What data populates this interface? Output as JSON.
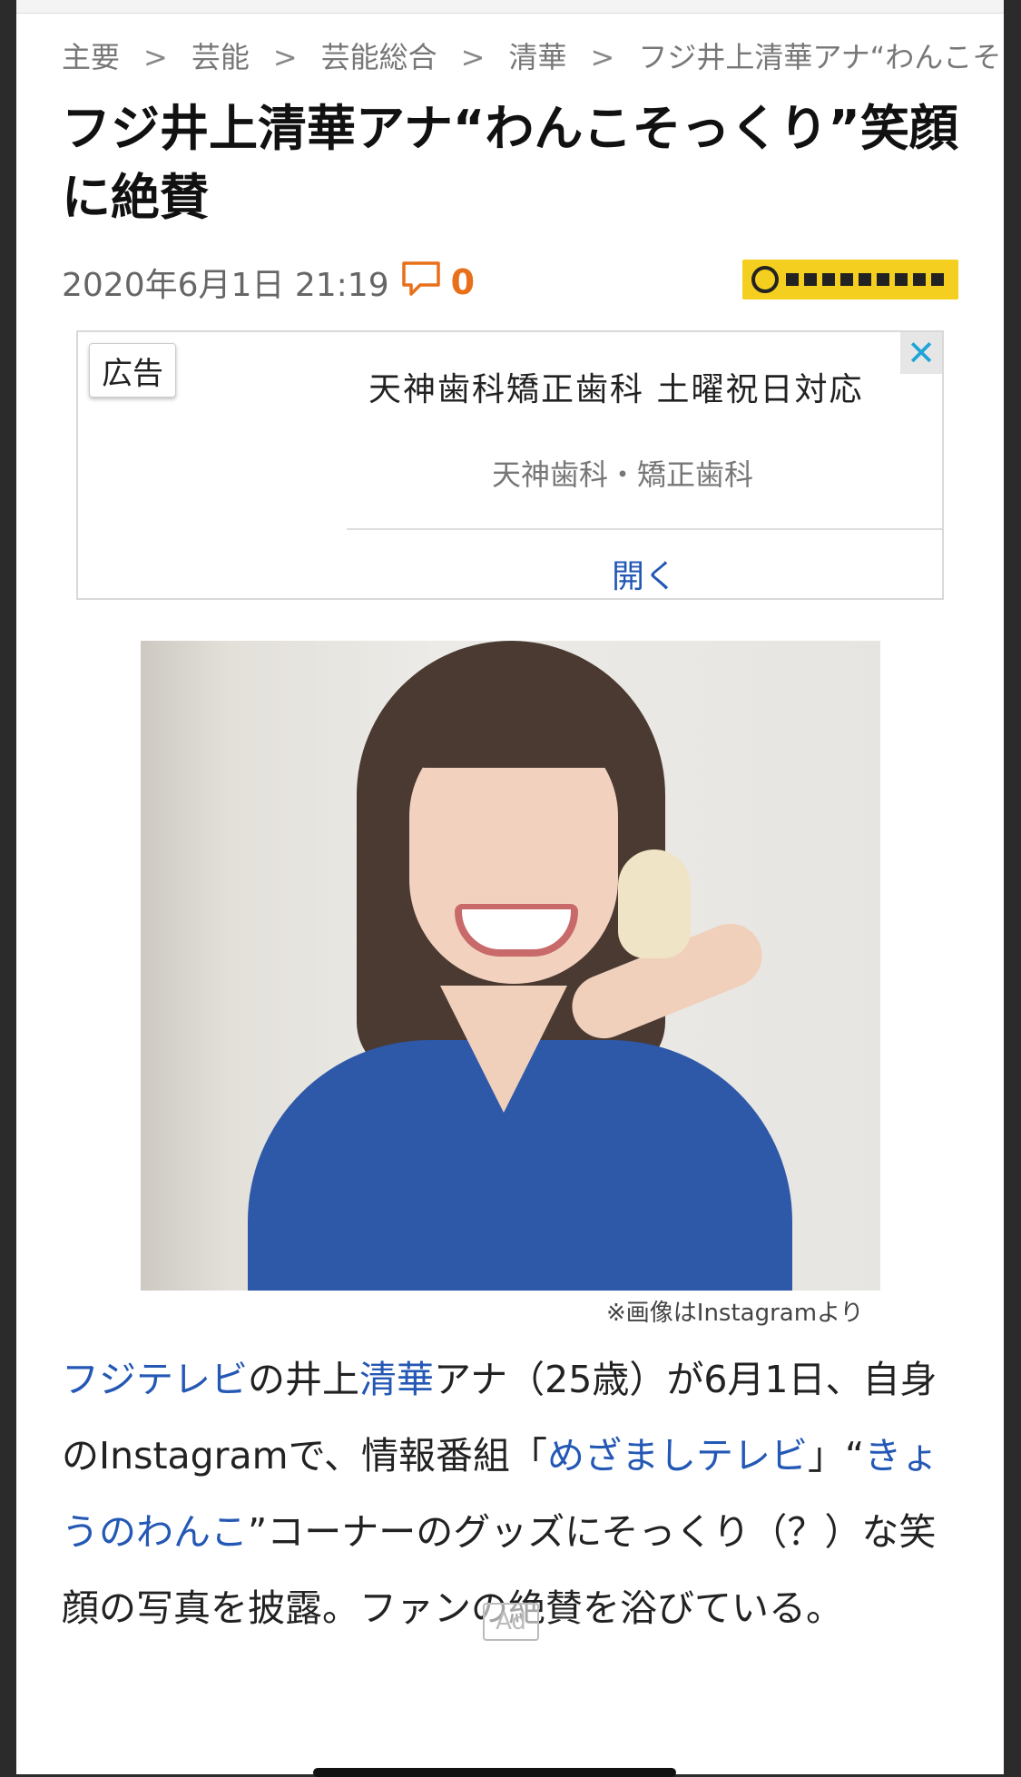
{
  "breadcrumb": [
    {
      "label": "主要"
    },
    {
      "label": "芸能"
    },
    {
      "label": "芸能総合"
    },
    {
      "label": "清華"
    },
    {
      "label": "フジ井上清華アナ“わんこそ"
    }
  ],
  "breadcrumb_separator": ">",
  "article": {
    "title": "フジ井上清華アナ“わんこそっくり”笑顔に絶賛",
    "datetime": "2020年6月1日 21:19",
    "comment_count": "0",
    "source_logo": "ナリナリドットコム",
    "image_caption": "※画像はInstagramより",
    "body": {
      "s1_link": "フジテレビ",
      "s2": "の井上",
      "s3_link": "清華",
      "s4": "アナ（25歳）が6月1日、自身のInstagramで、情報番組「",
      "s5_link": "めざましテレビ",
      "s6": "」“",
      "s7_link": "きょうのわんこ",
      "s8": "”コーナーのグッズにそっくり（？）な笑顔の写真を披露。ファンの絶賛を浴びている。"
    }
  },
  "ad": {
    "badge": "広告",
    "close": "✕",
    "headline": "天神歯科矯正歯科 土曜祝日対応",
    "advertiser": "天神歯科・矯正歯科",
    "cta": "開く",
    "mark": "Ad"
  },
  "colors": {
    "link": "#2458b5",
    "comment_accent": "#e8701a",
    "source_logo_bg": "#f5cf1f"
  },
  "icons": {
    "comment": "speech-bubble-icon",
    "close": "close-icon"
  }
}
